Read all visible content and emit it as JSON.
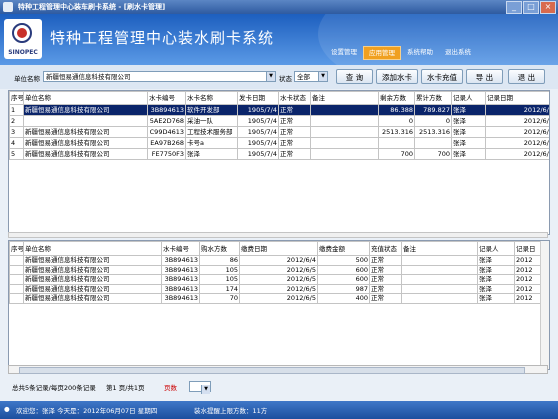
{
  "window": {
    "title": "特种工程管理中心装车刷卡系统 - [刷水卡管理]",
    "buttons": [
      "_",
      "□",
      "×"
    ]
  },
  "header": {
    "logo_text": "SINOPEC",
    "app_title": "特种工程管理中心装水刷卡系统",
    "menu": [
      {
        "label": "设置管理",
        "active": false
      },
      {
        "label": "应用管理",
        "active": true
      },
      {
        "label": "系统帮助",
        "active": false
      },
      {
        "label": "退出系统",
        "active": false
      }
    ]
  },
  "filter": {
    "unit_label": "单位名称",
    "unit_value": "新疆恒易通信息科技有限公司",
    "status_label": "状态",
    "status_value": "全部",
    "buttons": {
      "query": "查 询",
      "add_card": "添加水卡",
      "recharge": "水卡充值",
      "export": "导 出",
      "exit": "退 出"
    }
  },
  "cards_table": {
    "columns": [
      "序号",
      "单位名称",
      "水卡编号",
      "水卡名称",
      "发卡日期",
      "水卡状态",
      "备注",
      "剩余方数",
      "累计方数",
      "记录人",
      "记录日期"
    ],
    "rows": [
      [
        "1",
        "新疆恒易通信息科技有限公司",
        "3B894613",
        "软件开发部",
        "1905/7/4",
        "正常",
        "",
        "86.388",
        "789.827",
        "张泽",
        "2012/6/4"
      ],
      [
        "2",
        "",
        "5AE2D768",
        "采油一队",
        "1905/7/4",
        "正常",
        "",
        "0",
        "0",
        "张泽",
        "2012/6/4"
      ],
      [
        "3",
        "新疆恒易通信息科技有限公司",
        "C99D4613",
        "工程技术服务部",
        "1905/7/4",
        "正常",
        "",
        "2513.316",
        "2513.316",
        "张泽",
        "2012/6/4"
      ],
      [
        "4",
        "新疆恒易通信息科技有限公司",
        "EA97B268",
        "卡号a",
        "1905/7/4",
        "正常",
        "",
        "",
        "",
        "张泽",
        "2012/6/4"
      ],
      [
        "5",
        "新疆恒易通信息科技有限公司",
        "FE7750F3",
        "张泽",
        "1905/7/4",
        "正常",
        "",
        "700",
        "700",
        "张泽",
        "2012/6/3"
      ]
    ]
  },
  "purchase_table": {
    "columns": [
      "序号",
      "单位名称",
      "水卡编号",
      "购水方数",
      "缴费日期",
      "缴费金额",
      "充值状态",
      "备注",
      "记录人",
      "记录日"
    ],
    "rows": [
      [
        "",
        "新疆恒易通信息科技有限公司",
        "3B894613",
        "86",
        "2012/6/4",
        "500",
        "正常",
        "",
        "张泽",
        "2012"
      ],
      [
        "",
        "新疆恒易通信息科技有限公司",
        "3B894613",
        "105",
        "2012/6/5",
        "600",
        "正常",
        "",
        "张泽",
        "2012"
      ],
      [
        "",
        "新疆恒易通信息科技有限公司",
        "3B894613",
        "105",
        "2012/6/5",
        "600",
        "正常",
        "",
        "张泽",
        "2012"
      ],
      [
        "",
        "新疆恒易通信息科技有限公司",
        "3B894613",
        "174",
        "2012/6/5",
        "987",
        "正常",
        "",
        "张泽",
        "2012"
      ],
      [
        "",
        "新疆恒易通信息科技有限公司",
        "3B894613",
        "70",
        "2012/6/5",
        "400",
        "正常",
        "",
        "张泽",
        "2012"
      ]
    ]
  },
  "pager": {
    "summary": "总共5条记录/每页200条记录",
    "page_info": "第1 页/共1页",
    "page_label": "页数"
  },
  "status": {
    "welcome": "欢迎您：张泽  今天是：2012年06月07日 星期四",
    "alert": "装水提醒上限方数：11方"
  }
}
